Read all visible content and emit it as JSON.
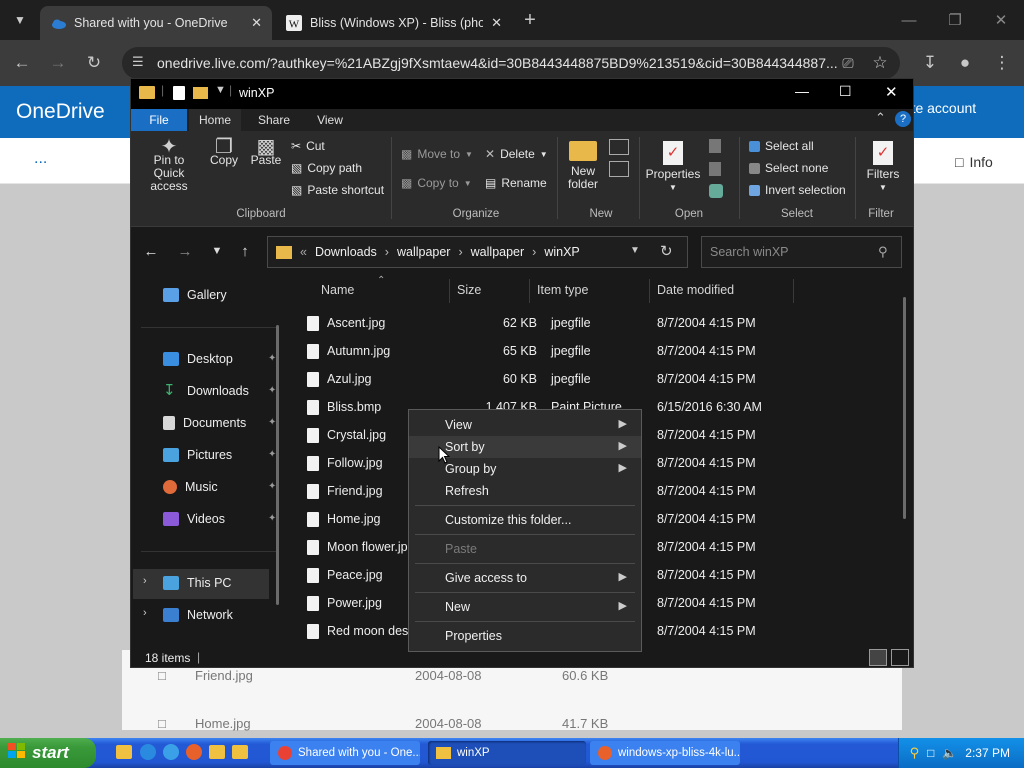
{
  "browser": {
    "tabs": [
      {
        "title": "Shared with you - OneDrive"
      },
      {
        "title": "Bliss (Windows XP) - Bliss (phot"
      }
    ],
    "url": "onedrive.live.com/?authkey=%21ABZgj9fXsmtaew4&id=30B8443448875BD9%213519&cid=30B844344887..."
  },
  "onedrive": {
    "logo": "OneDrive",
    "create_account": "eate account",
    "more": "...",
    "info": "Info",
    "rows": [
      {
        "name": "Friend.jpg",
        "date": "2004-08-08",
        "size": "60.6 KB"
      },
      {
        "name": "Home.jpg",
        "date": "2004-08-08",
        "size": "41.7 KB"
      }
    ]
  },
  "explorer": {
    "title": "winXP",
    "ribbon_tabs": [
      "File",
      "Home",
      "Share",
      "View"
    ],
    "clipboard": {
      "pin": "Pin to Quick access",
      "copy": "Copy",
      "paste": "Paste",
      "cut": "Cut",
      "copy_path": "Copy path",
      "paste_shortcut": "Paste shortcut",
      "group": "Clipboard"
    },
    "organize": {
      "move_to": "Move to",
      "copy_to": "Copy to",
      "delete": "Delete",
      "rename": "Rename",
      "group": "Organize"
    },
    "new": {
      "new_folder": "New folder",
      "group": "New"
    },
    "open": {
      "properties": "Properties",
      "group": "Open"
    },
    "select": {
      "select_all": "Select all",
      "select_none": "Select none",
      "invert": "Invert selection",
      "group": "Select"
    },
    "filter": {
      "filters": "Filters",
      "group": "Filter"
    },
    "path": [
      "Downloads",
      "wallpaper",
      "wallpaper",
      "winXP"
    ],
    "search_placeholder": "Search winXP",
    "nav": [
      {
        "label": "Gallery"
      },
      {
        "label": "Desktop"
      },
      {
        "label": "Downloads"
      },
      {
        "label": "Documents"
      },
      {
        "label": "Pictures"
      },
      {
        "label": "Music"
      },
      {
        "label": "Videos"
      },
      {
        "label": "This PC"
      },
      {
        "label": "Network"
      }
    ],
    "columns": {
      "name": "Name",
      "size": "Size",
      "type": "Item type",
      "date": "Date modified"
    },
    "files": [
      {
        "name": "Ascent.jpg",
        "size": "62 KB",
        "type": "jpegfile",
        "date": "8/7/2004 4:15 PM"
      },
      {
        "name": "Autumn.jpg",
        "size": "65 KB",
        "type": "jpegfile",
        "date": "8/7/2004 4:15 PM"
      },
      {
        "name": "Azul.jpg",
        "size": "60 KB",
        "type": "jpegfile",
        "date": "8/7/2004 4:15 PM"
      },
      {
        "name": "Bliss.bmp",
        "size": "1,407 KB",
        "type": "Paint Picture",
        "date": "6/15/2016 6:30 AM"
      },
      {
        "name": "Crystal.jpg",
        "size": "",
        "type": "",
        "date": "8/7/2004 4:15 PM"
      },
      {
        "name": "Follow.jpg",
        "size": "",
        "type": "",
        "date": "8/7/2004 4:15 PM"
      },
      {
        "name": "Friend.jpg",
        "size": "",
        "type": "",
        "date": "8/7/2004 4:15 PM"
      },
      {
        "name": "Home.jpg",
        "size": "",
        "type": "",
        "date": "8/7/2004 4:15 PM"
      },
      {
        "name": "Moon flower.jpg",
        "size": "",
        "type": "",
        "date": "8/7/2004 4:15 PM"
      },
      {
        "name": "Peace.jpg",
        "size": "",
        "type": "",
        "date": "8/7/2004 4:15 PM"
      },
      {
        "name": "Power.jpg",
        "size": "",
        "type": "",
        "date": "8/7/2004 4:15 PM"
      },
      {
        "name": "Red moon desert.jpg",
        "size": "",
        "type": "",
        "date": "8/7/2004 4:15 PM"
      }
    ],
    "status": "18 items"
  },
  "context_menu": {
    "view": "View",
    "sort_by": "Sort by",
    "group_by": "Group by",
    "refresh": "Refresh",
    "customize": "Customize this folder...",
    "paste": "Paste",
    "give_access": "Give access to",
    "new": "New",
    "properties": "Properties"
  },
  "taskbar": {
    "start": "start",
    "tasks": [
      {
        "label": "Shared with you - One..."
      },
      {
        "label": "winXP"
      },
      {
        "label": "windows-xp-bliss-4k-lu..."
      }
    ],
    "clock": "2:37 PM"
  },
  "colors": {
    "onedrive_blue": "#0f6cbd",
    "xp_taskbar": "#2257d3",
    "xp_start": "#3a9a3a"
  }
}
